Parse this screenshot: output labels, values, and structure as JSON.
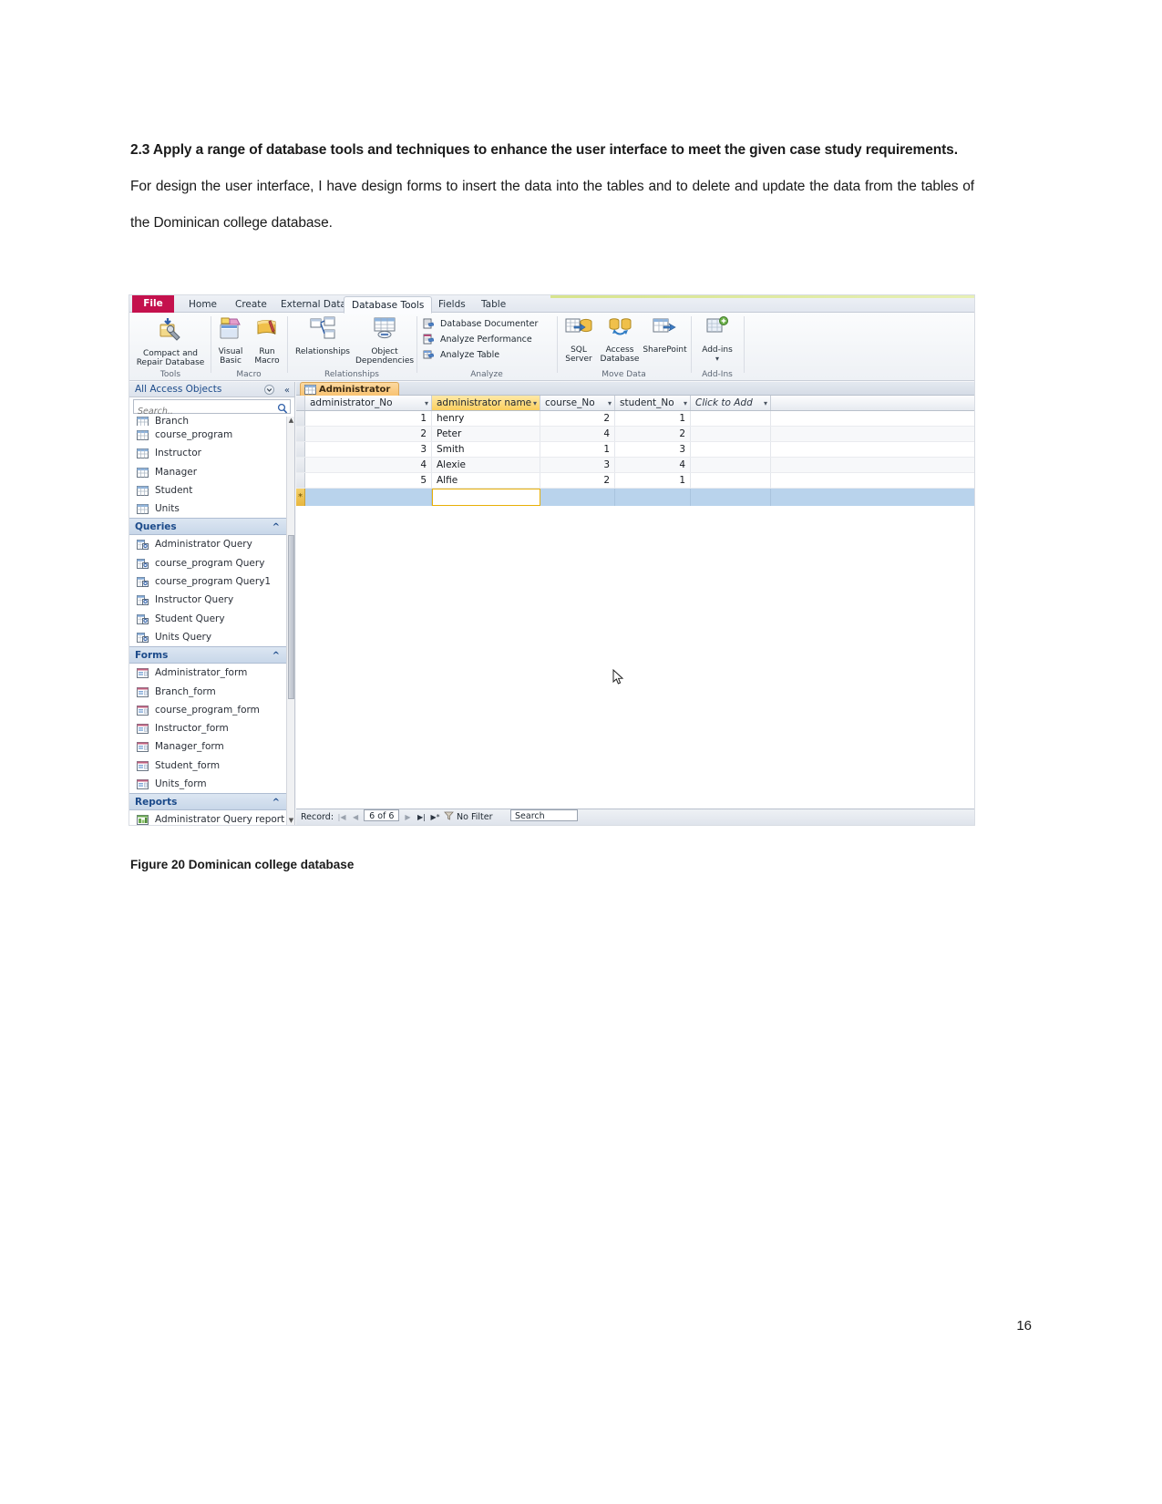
{
  "document": {
    "heading": "2.3 Apply a range of database tools and techniques to enhance the user interface to meet the given case study requirements.",
    "paragraph": "For design the user interface, I have design forms to insert the data into the tables and to delete and update the data from the tables of the Dominican college database.",
    "figure_caption": "Figure 20 Dominican college database",
    "page_number": "16"
  },
  "app": {
    "ribbon_tabs": [
      {
        "label": "File",
        "active": false
      },
      {
        "label": "Home",
        "active": false
      },
      {
        "label": "Create",
        "active": false
      },
      {
        "label": "External Data",
        "active": false
      },
      {
        "label": "Database Tools",
        "active": true
      },
      {
        "label": "Fields",
        "active": false
      },
      {
        "label": "Table",
        "active": false
      }
    ],
    "ribbon_groups": [
      {
        "name": "Tools",
        "buttons": [
          {
            "label": "Compact and Repair Database",
            "icon": "compact-repair-icon"
          }
        ]
      },
      {
        "name": "Macro",
        "buttons": [
          {
            "label": "Visual Basic",
            "icon": "visual-basic-icon"
          },
          {
            "label": "Run Macro",
            "icon": "run-macro-icon"
          }
        ]
      },
      {
        "name": "Relationships",
        "buttons": [
          {
            "label": "Relationships",
            "icon": "relationships-icon"
          },
          {
            "label": "Object Dependencies",
            "icon": "object-dependencies-icon"
          }
        ]
      },
      {
        "name": "Analyze",
        "items": [
          {
            "label": "Database Documenter",
            "icon": "database-documenter-icon"
          },
          {
            "label": "Analyze Performance",
            "icon": "analyze-performance-icon"
          },
          {
            "label": "Analyze Table",
            "icon": "analyze-table-icon"
          }
        ]
      },
      {
        "name": "Move Data",
        "buttons": [
          {
            "label": "SQL Server",
            "icon": "sql-server-icon"
          },
          {
            "label": "Access Database",
            "icon": "access-database-icon"
          },
          {
            "label": "SharePoint",
            "icon": "sharepoint-icon"
          }
        ]
      },
      {
        "name": "Add-Ins",
        "buttons": [
          {
            "label": "Add-ins",
            "icon": "add-ins-icon"
          }
        ]
      }
    ],
    "nav_pane": {
      "title": "All Access Objects",
      "search_placeholder": "Search..",
      "search_value": "",
      "sections": [
        {
          "type": "items",
          "items": [
            {
              "label": "Branch",
              "icon": "table-icon"
            },
            {
              "label": "course_program",
              "icon": "table-icon"
            },
            {
              "label": "Instructor",
              "icon": "table-icon"
            },
            {
              "label": "Manager",
              "icon": "table-icon"
            },
            {
              "label": "Student",
              "icon": "table-icon"
            },
            {
              "label": "Units",
              "icon": "table-icon"
            }
          ]
        },
        {
          "type": "group",
          "label": "Queries",
          "items": [
            {
              "label": "Administrator Query",
              "icon": "query-icon"
            },
            {
              "label": "course_program Query",
              "icon": "query-icon"
            },
            {
              "label": "course_program Query1",
              "icon": "query-icon"
            },
            {
              "label": "Instructor Query",
              "icon": "query-icon"
            },
            {
              "label": "Student Query",
              "icon": "query-icon"
            },
            {
              "label": "Units Query",
              "icon": "query-icon"
            }
          ]
        },
        {
          "type": "group",
          "label": "Forms",
          "items": [
            {
              "label": "Administrator_form",
              "icon": "form-icon"
            },
            {
              "label": "Branch_form",
              "icon": "form-icon"
            },
            {
              "label": "course_program_form",
              "icon": "form-icon"
            },
            {
              "label": "Instructor_form",
              "icon": "form-icon"
            },
            {
              "label": "Manager_form",
              "icon": "form-icon"
            },
            {
              "label": "Student_form",
              "icon": "form-icon"
            },
            {
              "label": "Units_form",
              "icon": "form-icon"
            }
          ]
        },
        {
          "type": "group",
          "label": "Reports",
          "items": [
            {
              "label": "Administrator Query report",
              "icon": "report-icon"
            }
          ]
        }
      ]
    },
    "document_tab": {
      "label": "Administrator",
      "icon": "table-icon"
    },
    "datasheet": {
      "columns": [
        "administrator_No",
        "administrator name",
        "course_No",
        "student_No"
      ],
      "add_new_column": "Click to Add",
      "selected_column": "administrator name",
      "rows": [
        {
          "administrator_No": "1",
          "administrator_name": "henry",
          "course_No": "2",
          "student_No": "1"
        },
        {
          "administrator_No": "2",
          "administrator_name": "Peter",
          "course_No": "4",
          "student_No": "2"
        },
        {
          "administrator_No": "3",
          "administrator_name": "Smith",
          "course_No": "1",
          "student_No": "3"
        },
        {
          "administrator_No": "4",
          "administrator_name": "Alexie",
          "course_No": "3",
          "student_No": "4"
        },
        {
          "administrator_No": "5",
          "administrator_name": "Alfie",
          "course_No": "2",
          "student_No": "1"
        }
      ],
      "new_row_marker": "*"
    },
    "record_navigator": {
      "label": "Record:",
      "position": "6 of 6",
      "filter_status": "No Filter",
      "search_placeholder": "Search",
      "first_icon": "first-record-icon",
      "prev_icon": "previous-record-icon",
      "next_icon": "next-record-icon",
      "last_icon": "last-record-icon",
      "new_icon": "new-record-icon"
    }
  }
}
